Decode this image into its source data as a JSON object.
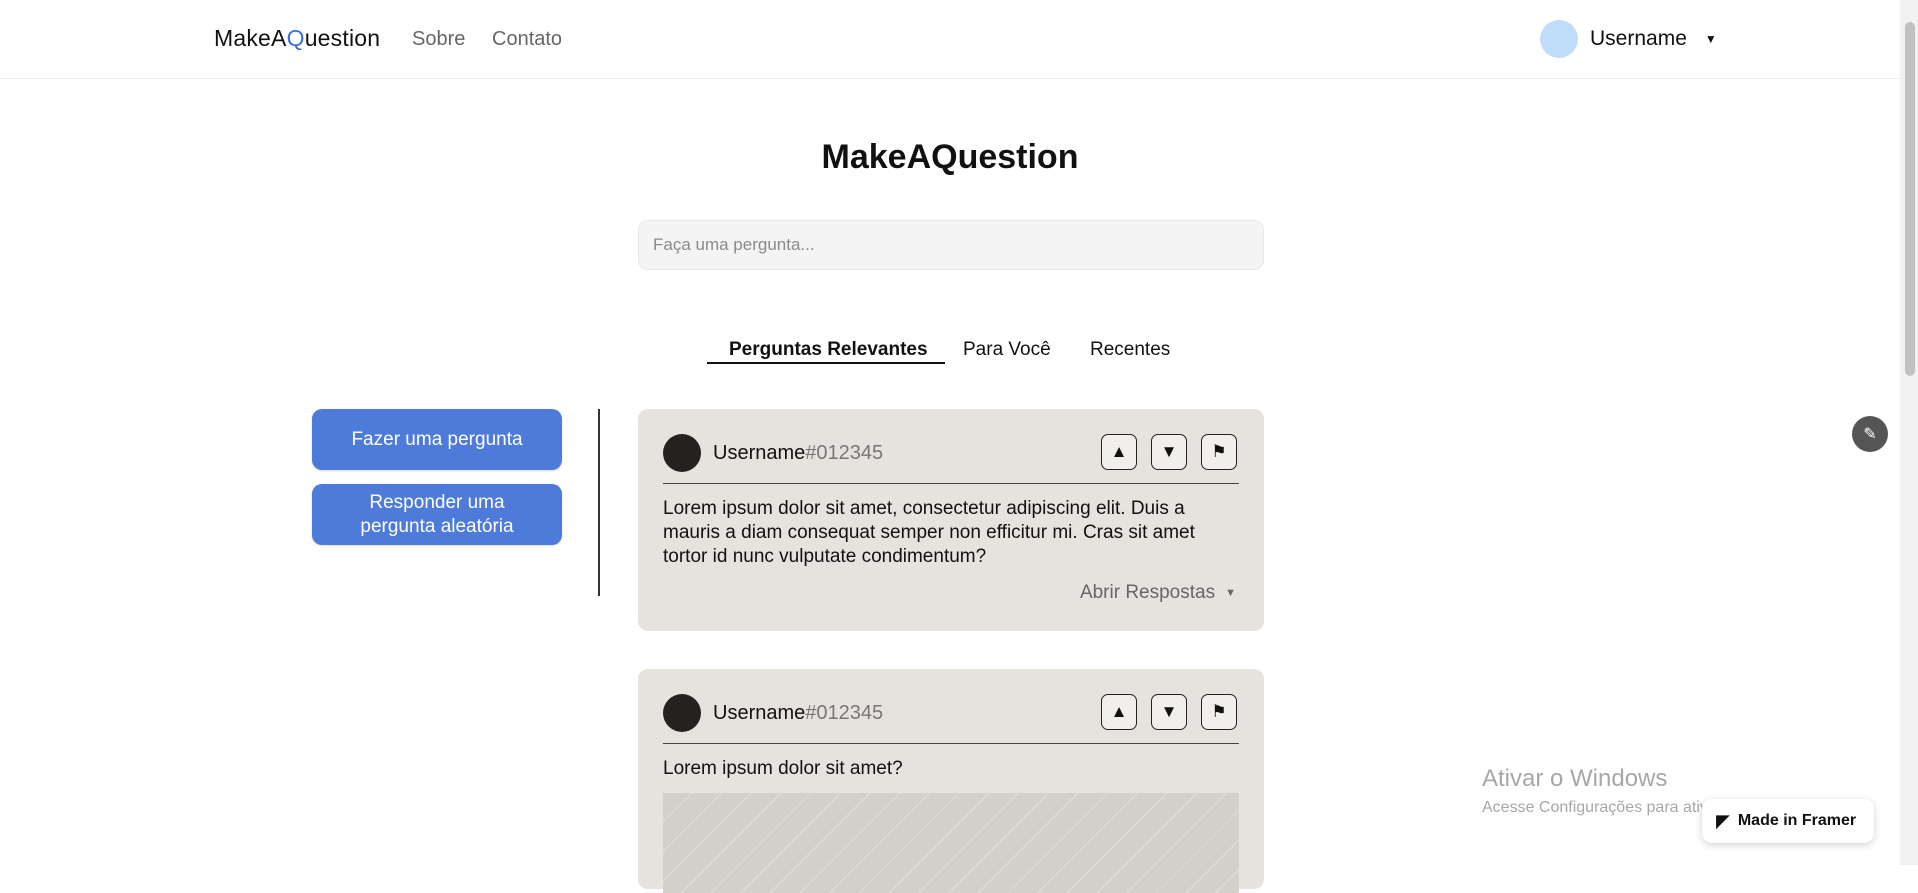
{
  "nav": {
    "logo_prefix": "MakeA",
    "logo_q": "Q",
    "logo_suffix": "uestion",
    "links": {
      "sobre": "Sobre",
      "contato": "Contato"
    },
    "user": {
      "name": "Username",
      "caret": "▼"
    }
  },
  "main": {
    "title": "MakeAQuestion",
    "search_placeholder": "Faça uma pergunta...",
    "tabs": {
      "relevantes": "Perguntas Relevantes",
      "para_voce": "Para Você",
      "recentes": "Recentes"
    }
  },
  "sidebar": {
    "ask_button": "Fazer uma pergunta",
    "random_button": "Responder uma pergunta aleatória"
  },
  "questions": [
    {
      "username": "Username",
      "user_id": "#012345",
      "text": "Lorem ipsum dolor sit amet, consectetur adipiscing elit. Duis a mauris a diam consequat semper non efficitur mi. Cras sit amet tortor id nunc vulputate condimentum?",
      "open_answers": "Abrir Respostas",
      "upvote_icon": "▲",
      "downvote_icon": "▼",
      "flag_icon": "⚑"
    },
    {
      "username": "Username",
      "user_id": "#012345",
      "text": "Lorem ipsum dolor sit amet?",
      "upvote_icon": "▲",
      "downvote_icon": "▼",
      "flag_icon": "⚑"
    }
  ],
  "overlay": {
    "windows_title": "Ativar o Windows",
    "windows_sub": "Acesse Configurações para ativar o Windows.",
    "framer_badge": "Made in Framer"
  },
  "colors": {
    "accent": "#4e7ad9",
    "card_bg": "#e6e2de",
    "avatar_nav": "#bfdcfb"
  }
}
